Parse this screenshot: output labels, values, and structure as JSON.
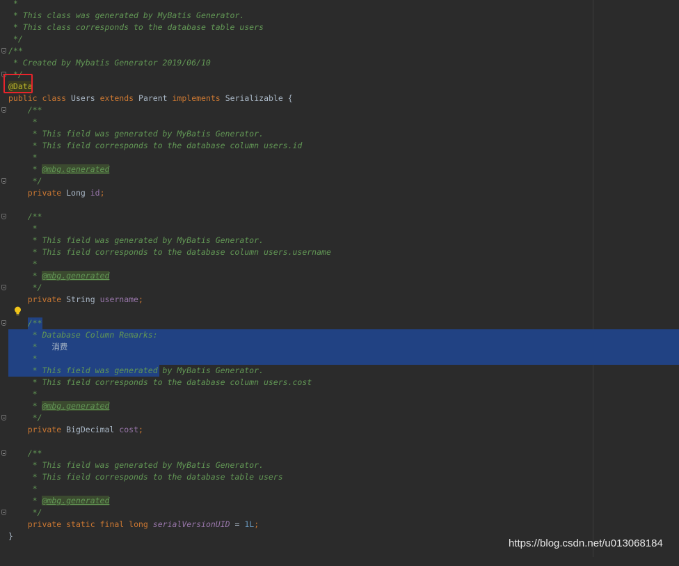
{
  "editor": {
    "lines": [
      {
        "text": " *"
      },
      {
        "text": " * This class was generated by MyBatis Generator."
      },
      {
        "text": " * This class corresponds to the database table users"
      },
      {
        "text": " */"
      },
      {
        "text": "/**"
      },
      {
        "text": " * Created by Mybatis Generator 2019/06/10"
      },
      {
        "text": " */"
      },
      {
        "annotation": "@Data"
      },
      {
        "kw1": "public",
        "kw2": "class",
        "name": "Users",
        "kw3": "extends",
        "parent": "Parent",
        "kw4": "implements",
        "iface": "Serializable",
        "brace": "{"
      },
      {
        "text": "    /**"
      },
      {
        "text": "     *"
      },
      {
        "text": "     * This field was generated by MyBatis Generator."
      },
      {
        "text": "     * This field corresponds to the database column users.id"
      },
      {
        "text": "     *"
      },
      {
        "prefix": "     * ",
        "tag": "@mbg.generated"
      },
      {
        "text": "     */"
      },
      {
        "kw": "private",
        "type": "Long",
        "field": "id",
        "end": ";"
      },
      {
        "text": ""
      },
      {
        "text": "    /**"
      },
      {
        "text": "     *"
      },
      {
        "text": "     * This field was generated by MyBatis Generator."
      },
      {
        "text": "     * This field corresponds to the database column users.username"
      },
      {
        "text": "     *"
      },
      {
        "prefix": "     * ",
        "tag": "@mbg.generated"
      },
      {
        "text": "     */"
      },
      {
        "kw": "private",
        "type": "String",
        "field": "username",
        "end": ";"
      },
      {
        "text": ""
      },
      {
        "text": "    /**"
      },
      {
        "text": "     * Database Column Remarks:"
      },
      {
        "prefix": "     *   ",
        "cn": "消费"
      },
      {
        "text": "     *"
      },
      {
        "text": "     * This field was generated by MyBatis Generator."
      },
      {
        "text": "     * This field corresponds to the database column users.cost"
      },
      {
        "text": "     *"
      },
      {
        "prefix": "     * ",
        "tag": "@mbg.generated"
      },
      {
        "text": "     */"
      },
      {
        "kw": "private",
        "type": "BigDecimal",
        "field": "cost",
        "end": ";"
      },
      {
        "text": ""
      },
      {
        "text": "    /**"
      },
      {
        "text": "     * This field was generated by MyBatis Generator."
      },
      {
        "text": "     * This field corresponds to the database table users"
      },
      {
        "text": "     *"
      },
      {
        "prefix": "     * ",
        "tag": "@mbg.generated"
      },
      {
        "text": "     */"
      },
      {
        "kw1": "private",
        "kw2": "static",
        "kw3": "final",
        "kw4": "long",
        "field": "serialVersionUID",
        "eq": " = ",
        "num": "1L",
        "end": ";"
      },
      {
        "text": "}"
      }
    ]
  },
  "watermark": "https://blog.csdn.net/u013068184",
  "colors": {
    "background": "#2b2b2b",
    "comment": "#629755",
    "keyword": "#cc7832",
    "annotation": "#bbb529",
    "field": "#9876aa",
    "number": "#6897bb",
    "selection": "#214283",
    "highlight_box": "#e8242b"
  },
  "icons": {
    "fold": "fold-marker-icon",
    "intention": "lightbulb-icon"
  }
}
